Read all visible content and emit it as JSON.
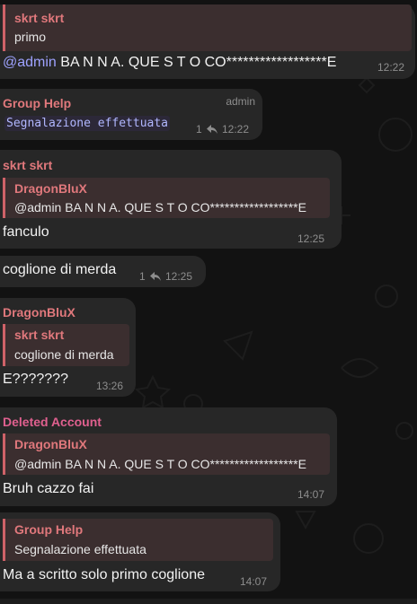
{
  "messages": [
    {
      "reply_name": "skrt skrt",
      "reply_text": "primo",
      "mention": "@admin",
      "text": " BA N N A.   QUE S T O CO******************E",
      "time": "12:22"
    },
    {
      "sender": "Group Help",
      "role": "admin",
      "code_text": "Segnalazione effettuata",
      "reply_count": "1",
      "time": "12:22"
    },
    {
      "sender": "skrt skrt",
      "reply_name": "DragonBluX",
      "reply_text": "@admin BA N N A. QUE S T O CO******************E",
      "text": "fanculo",
      "time": "12:25"
    },
    {
      "text": "coglione di merda",
      "reply_count": "1",
      "time": "12:25"
    },
    {
      "sender": "DragonBluX",
      "reply_name": "skrt skrt",
      "reply_text": "coglione di merda",
      "text": "E???????",
      "time": "13:26"
    },
    {
      "sender": "Deleted Account",
      "reply_name": "DragonBluX",
      "reply_text": "@admin BA N N A. QUE S T O CO******************E",
      "text": "Bruh cazzo fai",
      "time": "14:07"
    },
    {
      "reply_name": "Group Help",
      "reply_text": "Segnalazione effettuata",
      "text": "Ma a scritto solo primo coglione",
      "time": "14:07"
    }
  ],
  "colors": {
    "background": "#121212",
    "bubble": "#272727",
    "sender_name": "#e0787c",
    "deleted_account_name": "#e0608f",
    "mention": "#9ea2ff",
    "timestamp": "#8d8d8d"
  },
  "icons": {
    "reply_count": "reply-arrow-icon"
  }
}
